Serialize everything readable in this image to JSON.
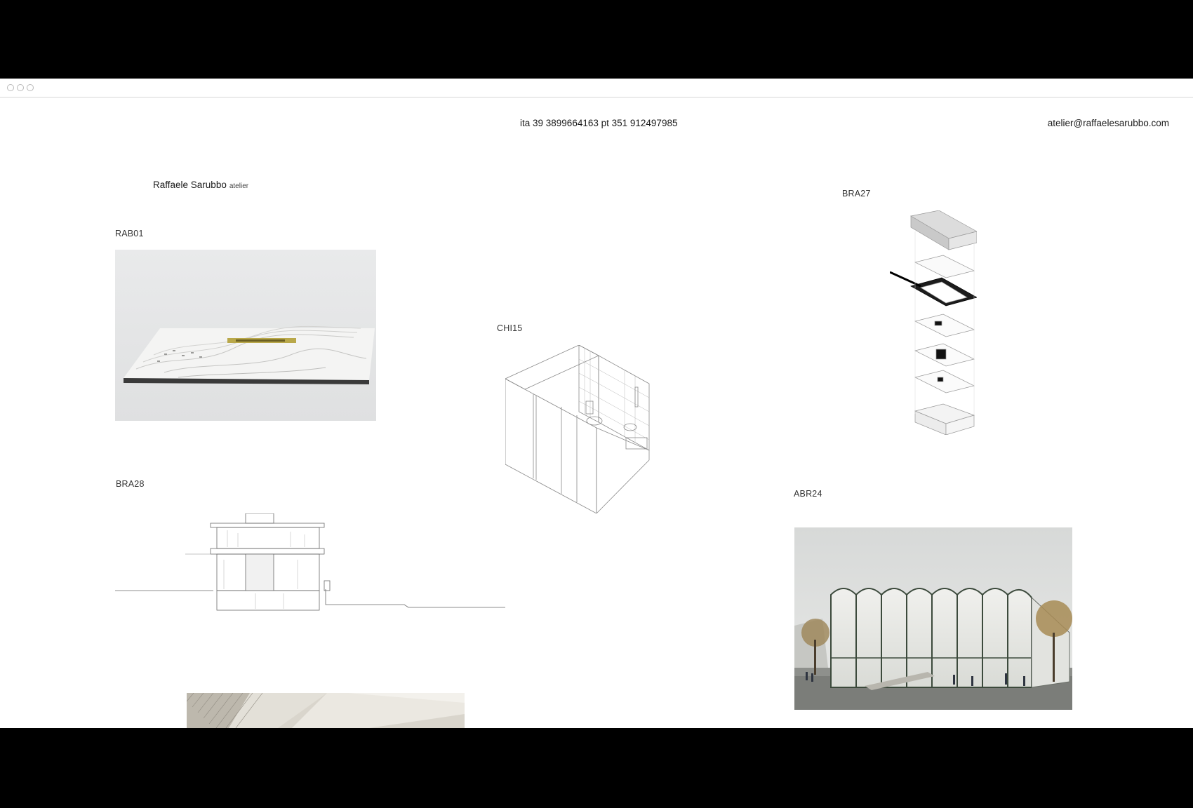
{
  "window": {
    "controls": [
      "close-dot",
      "minimize-dot",
      "zoom-dot"
    ]
  },
  "header": {
    "phone": "ita 39 3899664163  pt 351 912497985",
    "email": "atelier@raffaelesarubbo.com"
  },
  "brand": {
    "name": "Raffaele Sarubbo",
    "suffix": "atelier"
  },
  "projects": [
    {
      "code": "RAB01",
      "image": "topographic site model"
    },
    {
      "code": "CHI15",
      "image": "isometric bathroom drawing"
    },
    {
      "code": "BRA27",
      "image": "exploded axonometric"
    },
    {
      "code": "BRA28",
      "image": "building section drawing"
    },
    {
      "code": "ABR24",
      "image": "vaulted pavilion render"
    },
    {
      "code": "",
      "image": "interior vault photo"
    }
  ],
  "colors": {
    "background": "#ffffff",
    "frame": "#000000",
    "text": "#1a1a1a"
  }
}
